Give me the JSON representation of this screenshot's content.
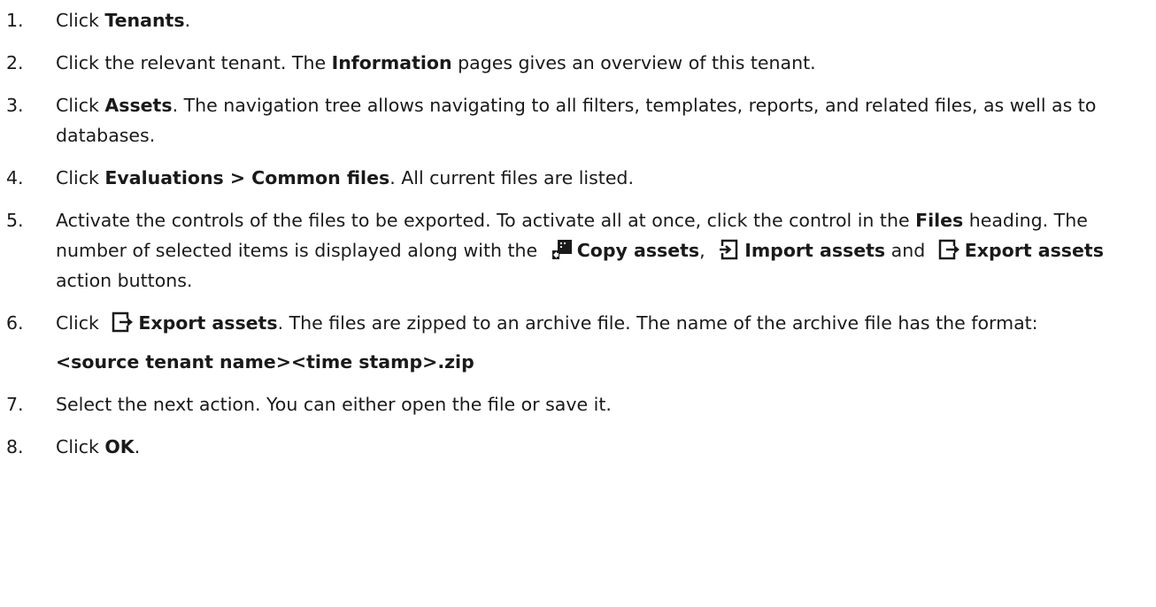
{
  "steps": [
    {
      "num": "1.",
      "parts": {
        "a": "Click ",
        "b": "Tenants",
        "c": "."
      }
    },
    {
      "num": "2.",
      "parts": {
        "a": "Click the relevant tenant. The ",
        "b": "Information",
        "c": " pages gives an overview of this tenant."
      }
    },
    {
      "num": "3.",
      "parts": {
        "a": "Click ",
        "b": "Assets",
        "c": ". The navigation tree allows navigating to all filters, templates, reports, and related files, as well as to databases."
      }
    },
    {
      "num": "4.",
      "parts": {
        "a": "Click ",
        "b": "Evaluations > Common files",
        "c": ". All current files are listed."
      }
    },
    {
      "num": "5.",
      "parts": {
        "a": "Activate the controls of the files to be exported. To activate all at once, click the control in the ",
        "b": "Files",
        "c": " heading. The number of selected items is displayed along with the ",
        "copy_label": "Copy assets",
        "d": ", ",
        "import_label": "Import assets",
        "e": " and ",
        "export_label": "Export assets",
        "f": " action buttons."
      }
    },
    {
      "num": "6.",
      "parts": {
        "a": "Click ",
        "export_label": "Export assets",
        "c": ". The files are zipped to an archive file. The name of the archive file has the format:"
      }
    },
    {
      "num": "7.",
      "parts": {
        "a": "Select the next action. You can either open the file or save it."
      }
    },
    {
      "num": "8.",
      "parts": {
        "a": "Click ",
        "b": "OK",
        "c": "."
      }
    }
  ],
  "archive_format": "<source tenant name><time stamp>.zip",
  "icons": {
    "copy": "copy-assets-icon",
    "import": "import-assets-icon",
    "export": "export-assets-icon"
  }
}
